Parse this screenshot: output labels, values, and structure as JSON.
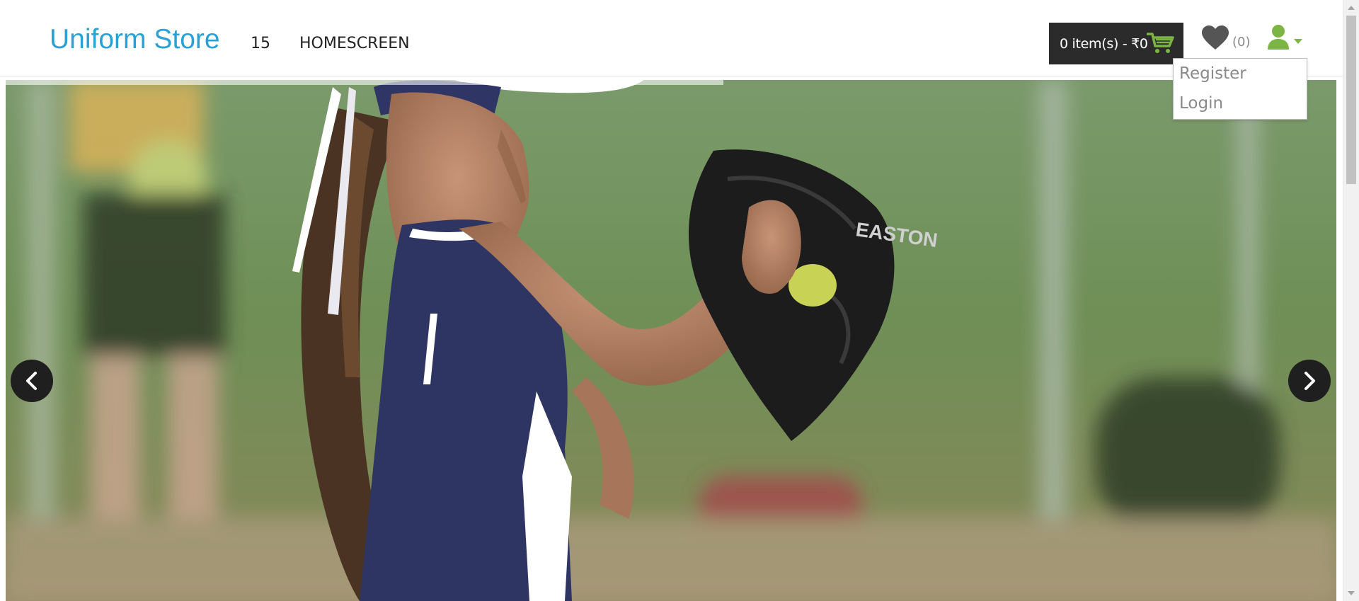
{
  "header": {
    "brand": "Uniform Store",
    "nav": [
      {
        "label": "15"
      },
      {
        "label": "HOMESCREEN"
      }
    ],
    "cart": {
      "label": "0 item(s) - ₹0"
    },
    "wishlist": {
      "count": "(0)"
    },
    "account_menu": {
      "items": [
        {
          "label": "Register"
        },
        {
          "label": "Login"
        }
      ]
    }
  },
  "slider": {
    "image_text": "EASTON"
  },
  "colors": {
    "brand": "#2aa1d6",
    "accent": "#7db544",
    "cart_bg": "#2b2b2b"
  },
  "icons": [
    "cart-icon",
    "heart-icon",
    "user-icon",
    "chevron-left-icon",
    "chevron-right-icon"
  ]
}
